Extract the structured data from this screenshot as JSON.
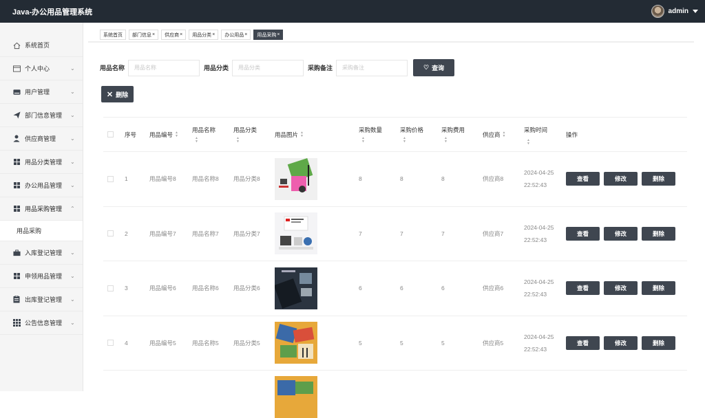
{
  "header": {
    "title": "Java-办公用品管理系统",
    "user": "admin"
  },
  "sidebar": {
    "items": [
      {
        "label": "系统首页",
        "icon": "home-icon"
      },
      {
        "label": "个人中心",
        "icon": "id-card-icon"
      },
      {
        "label": "用户管理",
        "icon": "user-card-icon"
      },
      {
        "label": "部门信息管理",
        "icon": "send-icon"
      },
      {
        "label": "供应商管理",
        "icon": "person-icon"
      },
      {
        "label": "用品分类管理",
        "icon": "grid-icon"
      },
      {
        "label": "办公用品管理",
        "icon": "grid-icon"
      },
      {
        "label": "用品采购管理",
        "icon": "grid-icon"
      },
      {
        "label": "入库登记管理",
        "icon": "briefcase-icon"
      },
      {
        "label": "申领用品管理",
        "icon": "grid-icon"
      },
      {
        "label": "出库登记管理",
        "icon": "clipboard-icon"
      },
      {
        "label": "公告信息管理",
        "icon": "apps-icon"
      }
    ],
    "submenu": "用品采购"
  },
  "tabs": [
    {
      "label": "系统首页",
      "closable": false
    },
    {
      "label": "部门信息",
      "closable": true
    },
    {
      "label": "供应商",
      "closable": true
    },
    {
      "label": "用品分类",
      "closable": true
    },
    {
      "label": "办公用品",
      "closable": true
    },
    {
      "label": "用品采购",
      "closable": true,
      "active": true
    }
  ],
  "search": {
    "name_label": "用品名称",
    "name_placeholder": "用品名称",
    "category_label": "用品分类",
    "category_placeholder": "用品分类",
    "remark_label": "采购备注",
    "remark_placeholder": "采购备注",
    "query_button": "查询"
  },
  "delete_button": "删除",
  "table": {
    "headers": [
      "序号",
      "用品编号",
      "用品名称",
      "用品分类",
      "用品图片",
      "采购数量",
      "采购价格",
      "采购费用",
      "供应商",
      "采购时间",
      "操作"
    ],
    "op_labels": {
      "view": "查看",
      "edit": "修改",
      "delete": "删除"
    },
    "rows": [
      {
        "seq": "1",
        "code": "用品编号8",
        "name": "用品名称8",
        "category": "用品分类8",
        "qty": "8",
        "price": "8",
        "fee": "8",
        "supplier": "供应商8",
        "date": "2024-04-25",
        "time": "22:52:43"
      },
      {
        "seq": "2",
        "code": "用品编号7",
        "name": "用品名称7",
        "category": "用品分类7",
        "qty": "7",
        "price": "7",
        "fee": "7",
        "supplier": "供应商7",
        "date": "2024-04-25",
        "time": "22:52:43"
      },
      {
        "seq": "3",
        "code": "用品编号6",
        "name": "用品名称6",
        "category": "用品分类6",
        "qty": "6",
        "price": "6",
        "fee": "6",
        "supplier": "供应商6",
        "date": "2024-04-25",
        "time": "22:52:43"
      },
      {
        "seq": "4",
        "code": "用品编号5",
        "name": "用品名称5",
        "category": "用品分类5",
        "qty": "5",
        "price": "5",
        "fee": "5",
        "supplier": "供应商5",
        "date": "2024-04-25",
        "time": "22:52:43"
      }
    ]
  },
  "colors": {
    "topbar": "#232b34",
    "accent": "#3f4650"
  }
}
